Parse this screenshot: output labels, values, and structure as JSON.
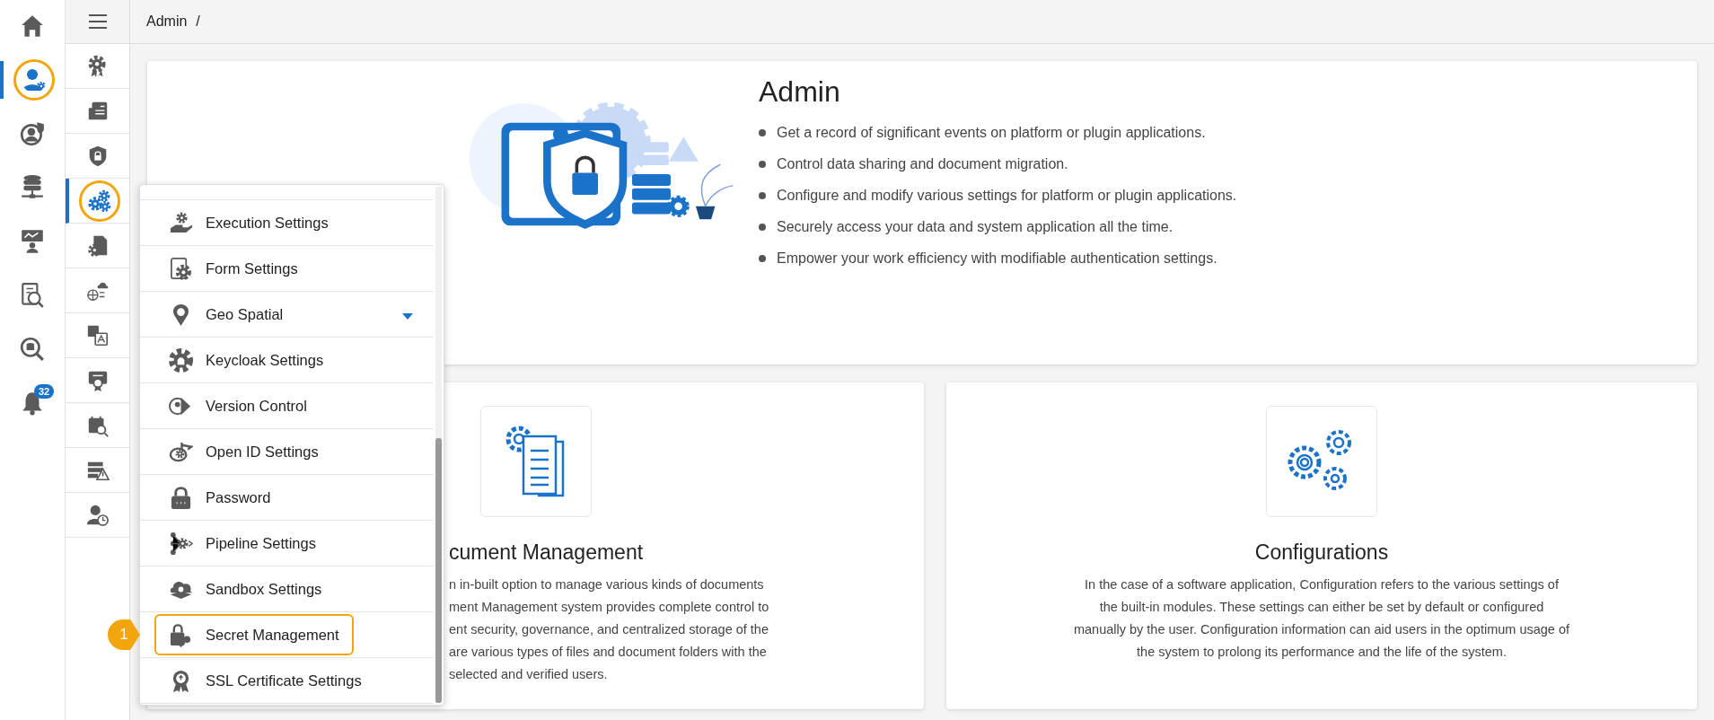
{
  "rail": [
    {
      "selected": false
    },
    {
      "selected": true
    },
    {
      "selected": false
    },
    {
      "selected": false
    },
    {
      "selected": false
    },
    {
      "selected": false
    },
    {
      "selected": false
    },
    {
      "selected": false,
      "badge": "32"
    }
  ],
  "subrail": [
    {
      "selected": false
    },
    {
      "selected": false
    },
    {
      "selected": false
    },
    {
      "selected": true
    },
    {
      "selected": false
    },
    {
      "selected": false
    },
    {
      "selected": false
    },
    {
      "selected": false
    },
    {
      "selected": false
    },
    {
      "selected": false
    },
    {
      "selected": false
    }
  ],
  "breadcrumb": {
    "label": "Admin",
    "separator": "/"
  },
  "hero": {
    "title": "Admin",
    "bullets": [
      "Get a record of significant events on platform or plugin applications.",
      "Control data sharing and document migration.",
      "Configure and modify various settings for platform or plugin applications.",
      "Securely access your data and system application all the time.",
      "Empower your work efficiency with modifiable authentication settings."
    ]
  },
  "cards": [
    {
      "kind": "partial",
      "title": "cument Management",
      "lines": [
        "n in-built option to manage various kinds of documents",
        "ment Management system provides complete control to",
        "ent security, governance, and centralized storage of the",
        "are various types of files and document folders with the",
        "selected and verified users."
      ]
    },
    {
      "kind": "full",
      "title": "Configurations",
      "lines": [
        "In the case of a software application, Configuration refers to the various settings of",
        "the built-in modules. These settings can either be set by default or configured",
        "manually by the user. Configuration information can aid users in the optimum usage of",
        "the system to prolong its performance and the life of the system."
      ]
    }
  ],
  "menu": [
    {
      "label": "Execution Settings",
      "submenu": false,
      "highlighted": false
    },
    {
      "label": "Form Settings",
      "submenu": false,
      "highlighted": false
    },
    {
      "label": "Geo Spatial",
      "submenu": true,
      "highlighted": false
    },
    {
      "label": "Keycloak Settings",
      "submenu": false,
      "highlighted": false
    },
    {
      "label": "Version Control",
      "submenu": false,
      "highlighted": false
    },
    {
      "label": "Open ID Settings",
      "submenu": false,
      "highlighted": false
    },
    {
      "label": "Password",
      "submenu": false,
      "highlighted": false
    },
    {
      "label": "Pipeline Settings",
      "submenu": false,
      "highlighted": false
    },
    {
      "label": "Sandbox Settings",
      "submenu": false,
      "highlighted": false
    },
    {
      "label": "Secret Management",
      "submenu": false,
      "highlighted": true,
      "callout": "1"
    },
    {
      "label": "SSL Certificate Settings",
      "submenu": false,
      "highlighted": false
    }
  ]
}
